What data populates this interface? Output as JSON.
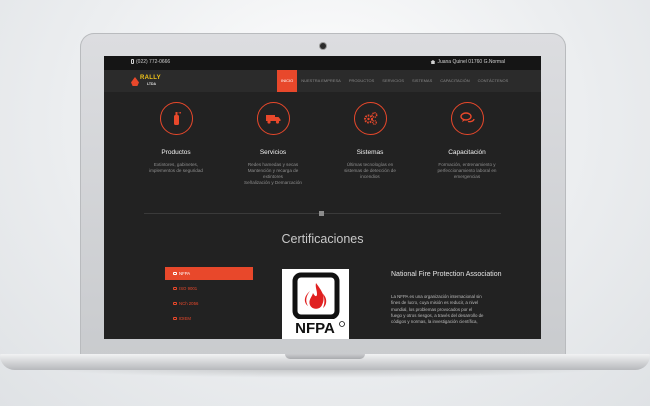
{
  "topbar": {
    "phone": "(022) 772-0666",
    "address": "Juana Quinel 01760 G.Normal"
  },
  "brand": {
    "name": "RALLY",
    "suffix": "LTDA"
  },
  "nav": {
    "items": [
      {
        "label": "INICIO"
      },
      {
        "label": "NUESTRA EMPRESA"
      },
      {
        "label": "PRODUCTOS"
      },
      {
        "label": "SERVICIOS"
      },
      {
        "label": "SISTEMAS"
      },
      {
        "label": "CAPACITACIÓN"
      },
      {
        "label": "CONTÁCTENOS"
      }
    ]
  },
  "services": [
    {
      "icon": "fire-extinguisher-icon",
      "title": "Productos",
      "lines": [
        "Extintores, gabinetes,",
        "implementos de seguridad"
      ]
    },
    {
      "icon": "truck-icon",
      "title": "Servicios",
      "lines": [
        "Redes hamedas y secas",
        "Mantención y recarga de",
        "extintores",
        "Señalización y Demarcación"
      ]
    },
    {
      "icon": "gears-icon",
      "title": "Sistemas",
      "lines": [
        "Últimas tecnologías en",
        "sistemas de detección de",
        "incendios"
      ]
    },
    {
      "icon": "chat-bubbles-icon",
      "title": "Capacitación",
      "lines": [
        "Formación, entrenamiento y",
        "perfeccionamiento laboral en",
        "emergencias"
      ]
    }
  ],
  "certifications": {
    "heading": "Certificaciones",
    "tabs": [
      {
        "label": "NFPA"
      },
      {
        "label": "ISO 9001"
      },
      {
        "label": "NCh 2056"
      },
      {
        "label": "IDIEM"
      }
    ],
    "logo_text": "NFPA",
    "detail_title": "National Fire Protection Association",
    "detail_lines": [
      "La NFPA es una organización internacional sin",
      "fines de lucro, cuya misión es reducir, a nivel",
      "mundial, los problemas provocados por el",
      "fuego y otros riesgos, a través del desarrollo de",
      "códigos y normas, la investigación científica,"
    ]
  },
  "colors": {
    "accent": "#e8482b",
    "background": "#222222",
    "topbar": "#151515"
  }
}
